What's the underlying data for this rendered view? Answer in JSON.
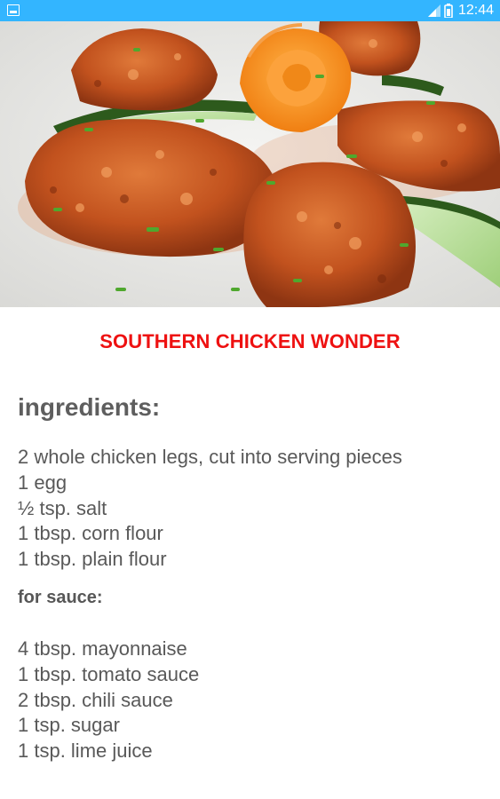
{
  "status_bar": {
    "time": "12:44",
    "icons": [
      "notification-icon",
      "signal-icon",
      "battery-icon"
    ]
  },
  "recipe": {
    "image": "fried-chicken-photo",
    "title": "SOUTHERN CHICKEN WONDER",
    "ingredients_heading": "ingredients:",
    "ingredients": [
      "2 whole chicken legs, cut into serving pieces",
      "1 egg",
      "½ tsp. salt",
      "1 tbsp. corn flour",
      "1 tbsp. plain flour"
    ],
    "sauce_heading": "for sauce:",
    "sauce": [
      "4 tbsp. mayonnaise",
      "1 tbsp. tomato sauce",
      "2 tbsp. chili sauce",
      "1 tsp. sugar",
      "1 tsp. lime juice"
    ]
  },
  "colors": {
    "status_bar": "#33B5FF",
    "title": "#EE1111",
    "body_text": "#595959"
  }
}
